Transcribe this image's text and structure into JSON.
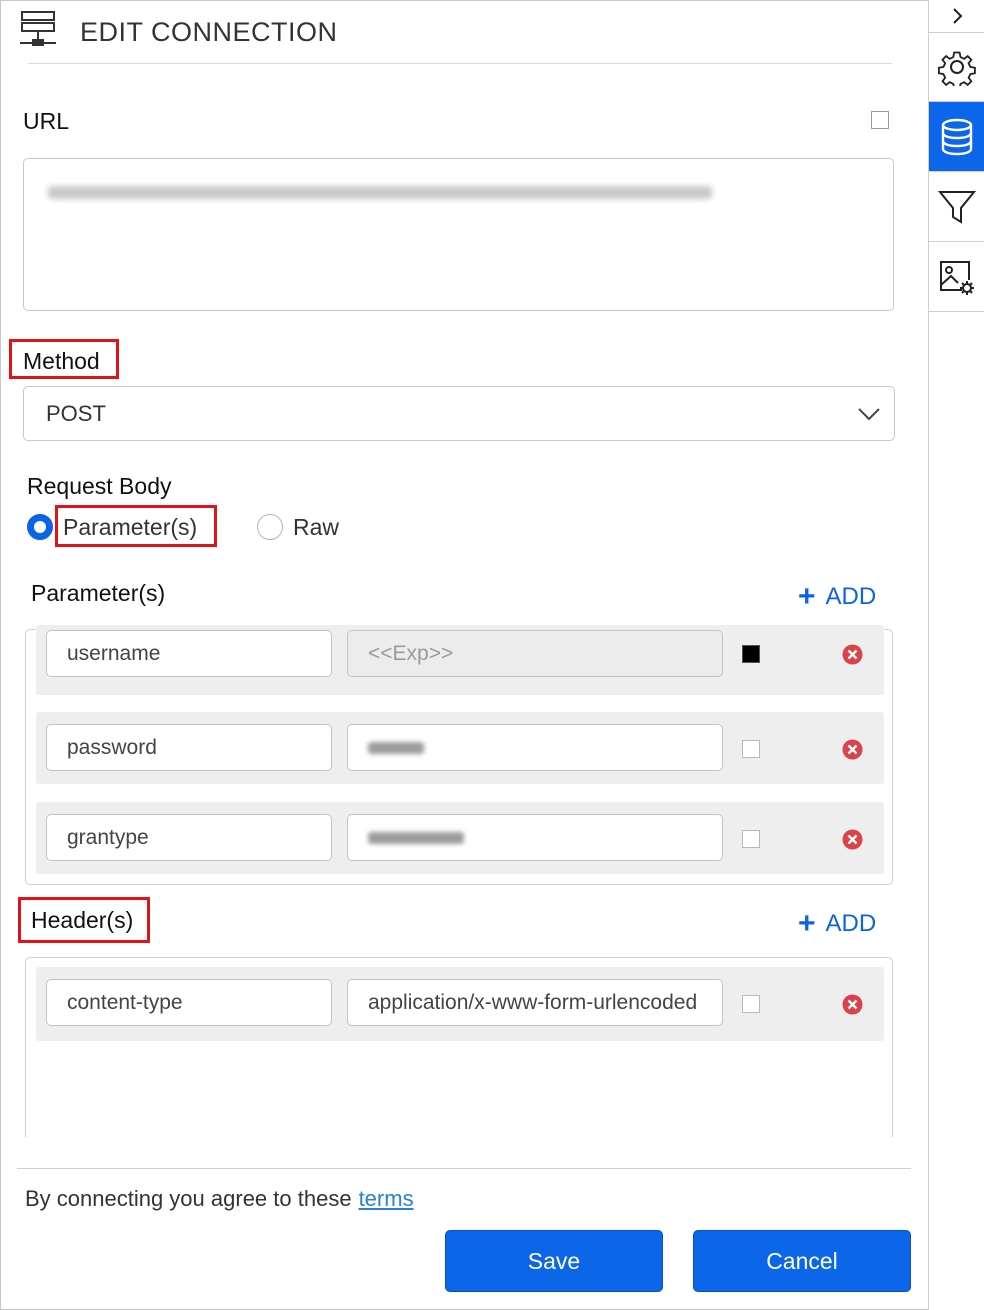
{
  "header": {
    "title": "EDIT CONNECTION",
    "icon": "server-network-icon"
  },
  "url": {
    "label": "URL",
    "value_redacted": true
  },
  "method": {
    "label": "Method",
    "selected": "POST"
  },
  "request_body": {
    "label": "Request Body",
    "options": [
      "Parameter(s)",
      "Raw"
    ],
    "selected": "Parameter(s)"
  },
  "parameters": {
    "label": "Parameter(s)",
    "add_label": "ADD",
    "rows": [
      {
        "key": "username",
        "value": "<<Exp>>",
        "value_disabled": true,
        "checked": true
      },
      {
        "key": "password",
        "value_redacted": true,
        "checked": false
      },
      {
        "key": "grantype",
        "value_redacted": true,
        "checked": false
      }
    ]
  },
  "headers": {
    "label": "Header(s)",
    "add_label": "ADD",
    "rows": [
      {
        "key": "content-type",
        "value": "application/x-www-form-urlencoded",
        "checked": false
      }
    ]
  },
  "footer": {
    "terms_prefix": "By connecting you agree to these",
    "terms_link": "terms",
    "save_label": "Save",
    "cancel_label": "Cancel"
  },
  "sidebar": {
    "items": [
      "chevron-right-icon",
      "gear-icon",
      "database-icon",
      "filter-icon",
      "image-settings-icon"
    ],
    "active": "database-icon"
  },
  "colors": {
    "accent": "#0b66e9",
    "highlight": "#e0131a",
    "delete": "#d9434b"
  }
}
